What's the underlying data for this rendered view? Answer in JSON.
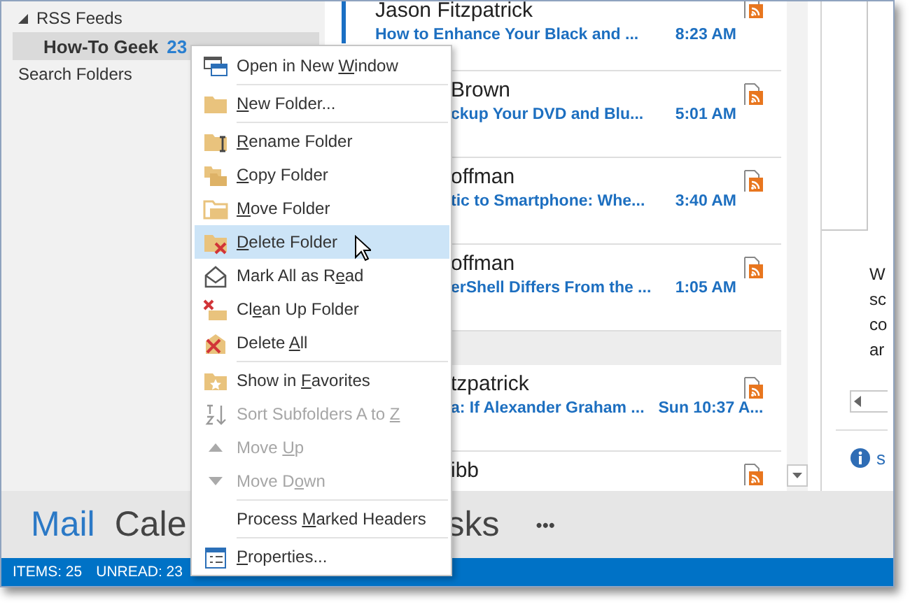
{
  "folders": [
    {
      "label": "RSS Feeds",
      "expanded": true,
      "selected": false,
      "children": [
        {
          "label": "How-To Geek",
          "count": "23",
          "selected": true
        }
      ]
    },
    {
      "label": "Search Folders",
      "selected": false
    }
  ],
  "messages": [
    {
      "kind": "message",
      "selected": true,
      "sender": "Jason Fitzpatrick",
      "subject": "How to Enhance Your Black and ...",
      "time": "8:23 AM"
    },
    {
      "kind": "message",
      "sender": "Brown",
      "subject": "ckup Your DVD and Blu...",
      "time": "5:01 AM"
    },
    {
      "kind": "message",
      "sender": "offman",
      "subject": "tic to Smartphone: Whe...",
      "time": "3:40 AM"
    },
    {
      "kind": "message",
      "sender": "offman",
      "subject": "erShell Differs From the ...",
      "time": "1:05 AM"
    },
    {
      "kind": "group_header"
    },
    {
      "kind": "message",
      "sender": "tzpatrick",
      "subject": "a: If Alexander Graham ...",
      "time": "Sun 10:37 A..."
    },
    {
      "kind": "message",
      "sender": "ibb"
    }
  ],
  "reading_pane": {
    "lines": [
      "W",
      "sc",
      "co",
      "ar"
    ],
    "info_text": "s"
  },
  "nav": {
    "items": [
      {
        "label": "Mail",
        "selected": true
      },
      {
        "label": "Cale",
        "selected": false
      },
      {
        "label": "sks",
        "selected": false
      }
    ],
    "more": "•••"
  },
  "status_bar": {
    "items": "ITEMS: 25",
    "unread": "UNREAD: 23"
  },
  "context_menu": [
    {
      "kind": "command",
      "before": "Open in New ",
      "key": "W",
      "after": "indow",
      "disabled": false,
      "selected": false
    },
    {
      "kind": "separator"
    },
    {
      "kind": "command",
      "key": "N",
      "after": "ew Folder...",
      "disabled": false,
      "selected": false
    },
    {
      "kind": "separator"
    },
    {
      "kind": "command",
      "key": "R",
      "after": "ename Folder",
      "disabled": false,
      "selected": false
    },
    {
      "kind": "command",
      "key": "C",
      "after": "opy Folder",
      "disabled": false,
      "selected": false
    },
    {
      "kind": "command",
      "key": "M",
      "after": "ove Folder",
      "disabled": false,
      "selected": false
    },
    {
      "kind": "command",
      "key": "D",
      "after": "elete Folder",
      "disabled": false,
      "selected": true
    },
    {
      "kind": "command",
      "before": "Mark All as R",
      "key": "e",
      "after": "ad",
      "disabled": false,
      "selected": false
    },
    {
      "kind": "command",
      "before": "Cl",
      "key": "e",
      "after": "an Up Folder",
      "disabled": false,
      "selected": false
    },
    {
      "kind": "command",
      "before": "Delete ",
      "key": "A",
      "after": "ll",
      "disabled": false,
      "selected": false
    },
    {
      "kind": "separator"
    },
    {
      "kind": "command",
      "before": "Show in ",
      "key": "F",
      "after": "avorites",
      "disabled": false,
      "selected": false
    },
    {
      "kind": "command",
      "before": "Sort Subfolders A to ",
      "key": "Z",
      "disabled": true,
      "selected": false
    },
    {
      "kind": "command",
      "before": "Move ",
      "key": "U",
      "after": "p",
      "disabled": true,
      "selected": false
    },
    {
      "kind": "command",
      "before": "Move D",
      "key": "o",
      "after": "wn",
      "disabled": true,
      "selected": false
    },
    {
      "kind": "separator"
    },
    {
      "kind": "command",
      "before": "Process ",
      "key": "M",
      "after": "arked Headers",
      "disabled": false,
      "selected": false
    },
    {
      "kind": "separator"
    },
    {
      "kind": "command",
      "key": "P",
      "after": "roperties...",
      "disabled": false,
      "selected": false
    }
  ]
}
